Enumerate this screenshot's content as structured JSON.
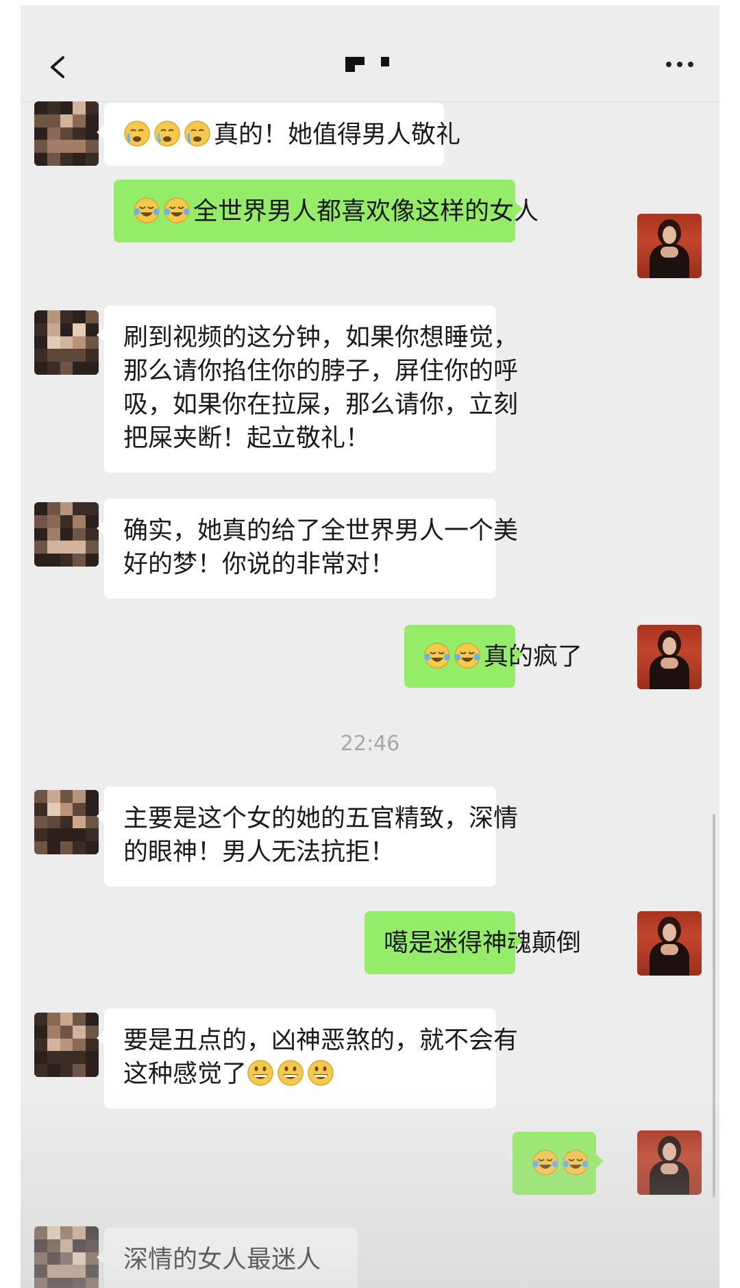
{
  "header": {
    "back_icon": "chevron-left-icon",
    "more_icon": "more-horizontal-icon"
  },
  "colors": {
    "chat_background": "#ededed",
    "outgoing_bubble": "#95ec69",
    "incoming_bubble": "#ffffff"
  },
  "messages": [
    {
      "side": "in",
      "emoji": [
        "crying-face",
        "crying-face",
        "crying-face"
      ],
      "lines": [
        "真的！她值得男人敬礼"
      ]
    },
    {
      "side": "out",
      "emoji": [
        "tears-of-joy",
        "tears-of-joy"
      ],
      "lines": [
        "全世界男人都喜欢像这样的女人"
      ]
    },
    {
      "side": "in",
      "emoji": [],
      "lines": [
        "刷到视频的这分钟，如果你想睡觉，",
        "那么请你掐住你的脖子，屏住你的呼",
        "吸，如果你在拉屎，那么请你，立刻",
        "把屎夹断！起立敬礼！"
      ]
    },
    {
      "side": "in",
      "emoji": [],
      "lines": [
        "确实，她真的给了全世界男人一个美",
        "好的梦！你说的非常对！"
      ]
    },
    {
      "side": "out",
      "emoji": [
        "tears-of-joy",
        "tears-of-joy"
      ],
      "lines": [
        "真的疯了"
      ]
    },
    {
      "side": "in",
      "emoji": [],
      "lines": [
        "主要是这个女的她的五官精致，深情",
        "的眼神！男人无法抗拒！"
      ]
    },
    {
      "side": "out",
      "emoji": [],
      "lines": [
        "噶是迷得神魂颠倒"
      ]
    },
    {
      "side": "in",
      "emoji_after": [
        "grinning-face",
        "grinning-face",
        "grinning-face"
      ],
      "lines": [
        "要是丑点的，凶神恶煞的，就不会有",
        "这种感觉了"
      ]
    },
    {
      "side": "out",
      "emoji": [
        "tears-of-joy",
        "tears-of-joy"
      ],
      "lines": []
    },
    {
      "side": "in",
      "emoji": [],
      "lines": [
        "深情的女人最迷人"
      ]
    }
  ],
  "timestamp": "22:46"
}
